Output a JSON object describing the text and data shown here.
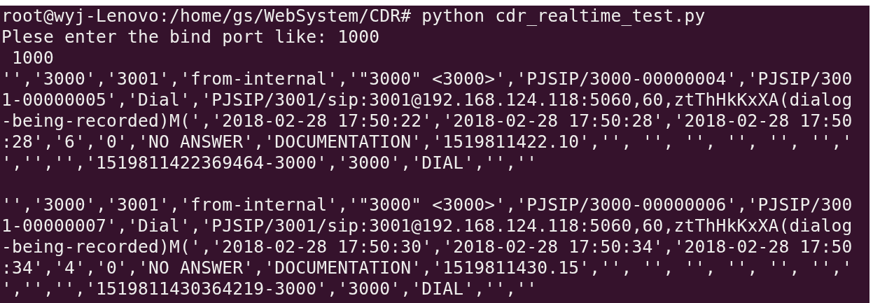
{
  "terminal": {
    "prompt_line": "root@wyj-Lenovo:/home/gs/WebSystem/CDR# python cdr_realtime_test.py",
    "output": [
      "Plese enter the bind port like: 1000",
      " 1000"
    ],
    "records": [
      [
        "'','3000','3001','from-internal','\"3000\" <3000>','PJSIP/3000-00000004','PJSIP/300",
        "1-00000005','Dial','PJSIP/3001/sip:3001@192.168.124.118:5060,60,ztThHkKxXA(dialog",
        "-being-recorded)M(','2018-02-28 17:50:22','2018-02-28 17:50:28','2018-02-28 17:50",
        ":28','6','0','NO ANSWER','DOCUMENTATION','1519811422.10','', '', '', '', '', '','",
        "','','','1519811422369464-3000','3000','DIAL','',''"
      ],
      [
        "'','3000','3001','from-internal','\"3000\" <3000>','PJSIP/3000-00000006','PJSIP/300",
        "1-00000007','Dial','PJSIP/3001/sip:3001@192.168.124.118:5060,60,ztThHkKxXA(dialog",
        "-being-recorded)M(','2018-02-28 17:50:30','2018-02-28 17:50:34','2018-02-28 17:50",
        ":34','4','0','NO ANSWER','DOCUMENTATION','1519811430.15','', '', '', '', '', '','",
        "','','','1519811430364219-3000','3000','DIAL','',''"
      ]
    ]
  }
}
